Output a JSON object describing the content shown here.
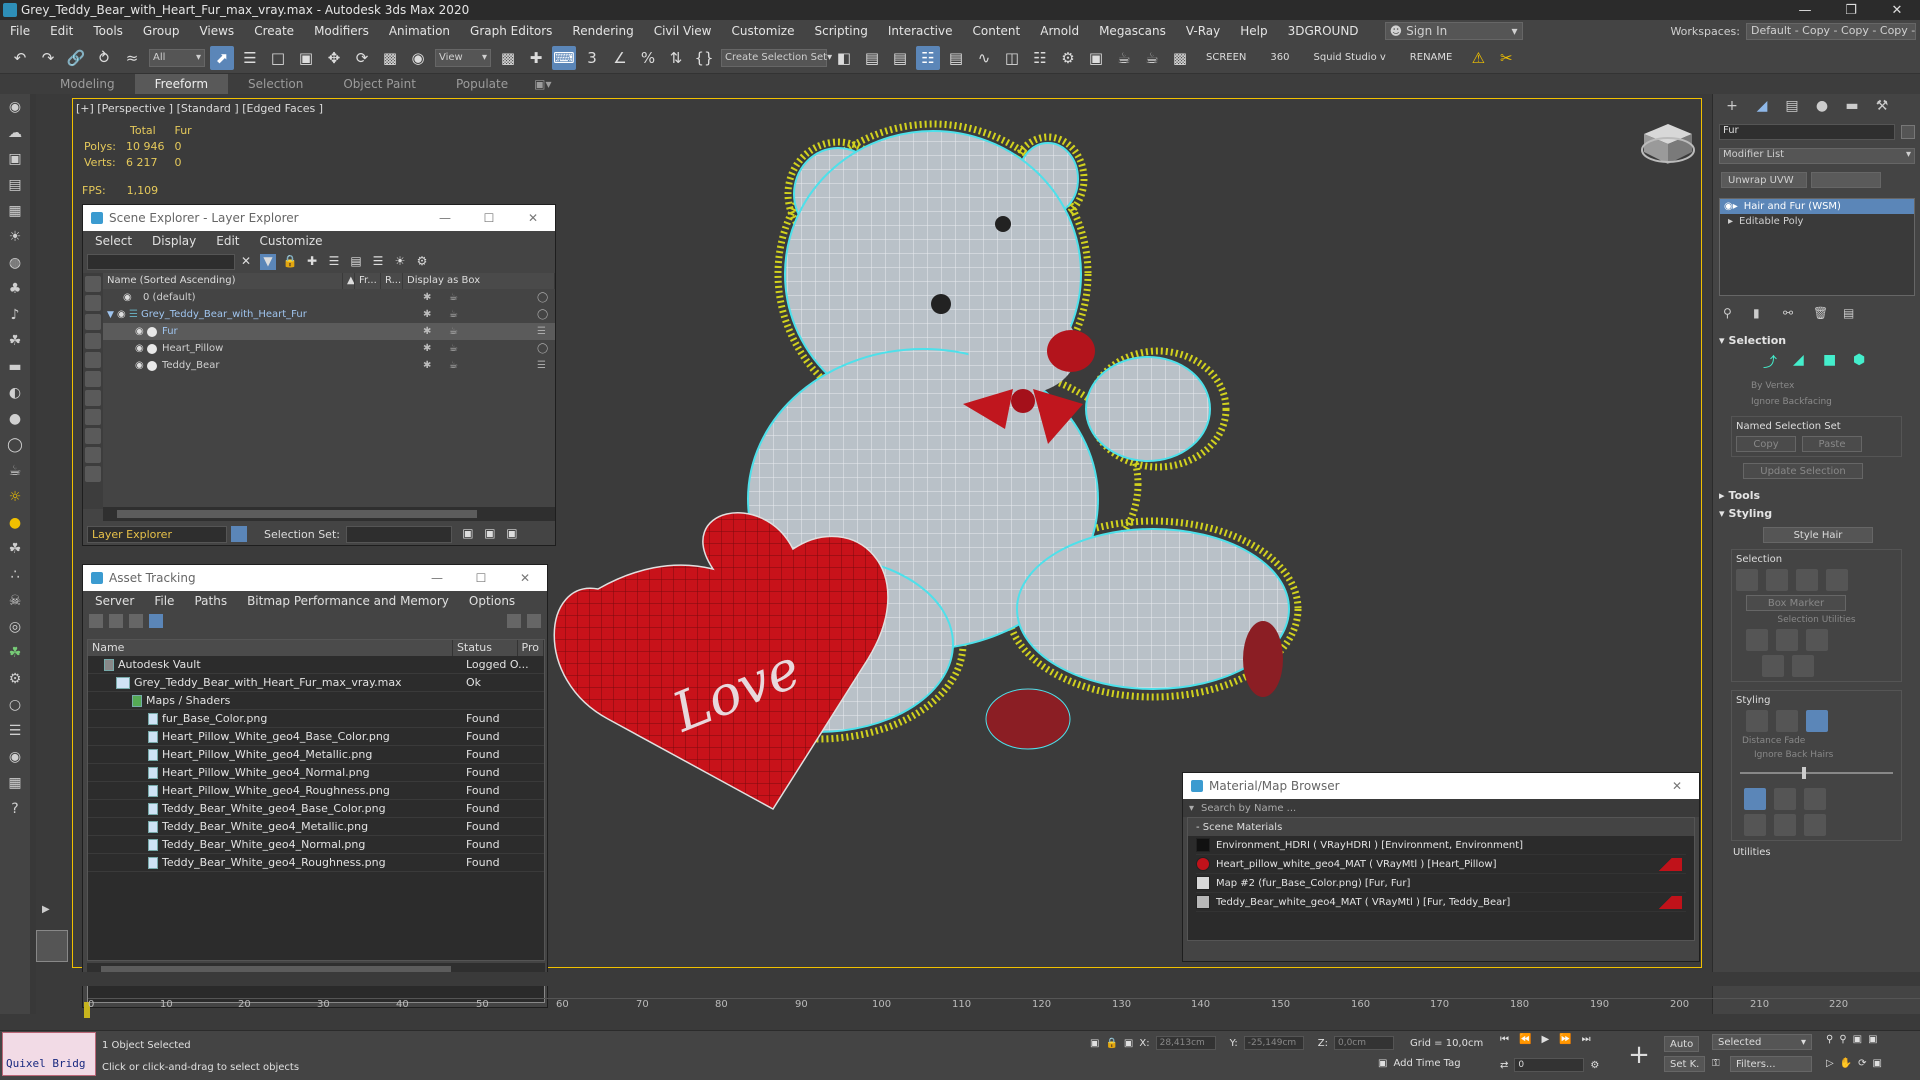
{
  "window": {
    "title": "Grey_Teddy_Bear_with_Heart_Fur_max_vray.max - Autodesk 3ds Max 2020"
  },
  "menu": {
    "items": [
      "File",
      "Edit",
      "Tools",
      "Group",
      "Views",
      "Create",
      "Modifiers",
      "Animation",
      "Graph Editors",
      "Rendering",
      "Civil View",
      "Customize",
      "Scripting",
      "Interactive",
      "Content",
      "Arnold",
      "Megascans",
      "V-Ray",
      "Help",
      "3DGROUND"
    ],
    "sign_in": "Sign In",
    "workspaces_label": "Workspaces:",
    "workspace_value": "Default - Copy - Copy - Copy - Copy"
  },
  "toolbar": {
    "filter": "All",
    "ref_coord": "View",
    "selection_set": "Create Selection Set",
    "screen": "SCREEN",
    "num360": "360",
    "squid": "Squid Studio v",
    "rename": "RENAME"
  },
  "ribbon": {
    "tabs": [
      "Modeling",
      "Freeform",
      "Selection",
      "Object Paint",
      "Populate"
    ],
    "active": "Freeform"
  },
  "viewport": {
    "label": "[+] [Perspective ] [Standard ] [Edged Faces ]",
    "stats": {
      "head_total": "Total",
      "head_fur": "Fur",
      "polys_label": "Polys:",
      "polys_total": "10 946",
      "polys_fur": "0",
      "verts_label": "Verts:",
      "verts_total": "6 217",
      "verts_fur": "0"
    },
    "fps_label": "FPS:",
    "fps_value": "1,109",
    "heart_text": "Love"
  },
  "scene_explorer": {
    "title": "Scene Explorer - Layer Explorer",
    "menu": [
      "Select",
      "Display",
      "Edit",
      "Customize"
    ],
    "col_name": "Name (Sorted Ascending)",
    "col_fr": "Fr...",
    "col_r": "R...",
    "col_box": "Display as Box",
    "rows": [
      {
        "name": "0 (default)",
        "indent": 1
      },
      {
        "name": "Grey_Teddy_Bear_with_Heart_Fur",
        "indent": 0
      },
      {
        "name": "Fur",
        "indent": 2
      },
      {
        "name": "Heart_Pillow",
        "indent": 2
      },
      {
        "name": "Teddy_Bear",
        "indent": 2
      }
    ],
    "explorer_type": "Layer Explorer",
    "selection_set_label": "Selection Set:"
  },
  "asset_tracking": {
    "title": "Asset Tracking",
    "menu": [
      "Server",
      "File",
      "Paths",
      "Bitmap Performance and Memory",
      "Options"
    ],
    "col_name": "Name",
    "col_status": "Status",
    "col_pro": "Pro",
    "rows": [
      {
        "name": "Autodesk Vault",
        "status": "Logged O..."
      },
      {
        "name": "Grey_Teddy_Bear_with_Heart_Fur_max_vray.max",
        "status": "Ok"
      },
      {
        "name": "Maps / Shaders",
        "status": ""
      },
      {
        "name": "fur_Base_Color.png",
        "status": "Found"
      },
      {
        "name": "Heart_Pillow_White_geo4_Base_Color.png",
        "status": "Found"
      },
      {
        "name": "Heart_Pillow_White_geo4_Metallic.png",
        "status": "Found"
      },
      {
        "name": "Heart_Pillow_White_geo4_Normal.png",
        "status": "Found"
      },
      {
        "name": "Heart_Pillow_White_geo4_Roughness.png",
        "status": "Found"
      },
      {
        "name": "Teddy_Bear_White_geo4_Base_Color.png",
        "status": "Found"
      },
      {
        "name": "Teddy_Bear_White_geo4_Metallic.png",
        "status": "Found"
      },
      {
        "name": "Teddy_Bear_White_geo4_Normal.png",
        "status": "Found"
      },
      {
        "name": "Teddy_Bear_White_geo4_Roughness.png",
        "status": "Found"
      }
    ]
  },
  "material_browser": {
    "title": "Material/Map Browser",
    "search_placeholder": "Search by Name ...",
    "group": "- Scene Materials",
    "rows": [
      {
        "name": "Environment_HDRI  ( VRayHDRI ) [Environment, Environment]",
        "swatch": "#111111"
      },
      {
        "name": "Heart_pillow_white_geo4_MAT  ( VRayMtl ) [Heart_Pillow]",
        "swatch": "#c0121a"
      },
      {
        "name": "Map #2 (fur_Base_Color.png) [Fur, Fur]",
        "swatch": "#d8d8d8"
      },
      {
        "name": "Teddy_Bear_white_geo4_MAT  ( VRayMtl ) [Fur, Teddy_Bear]",
        "swatch": "#b8b8b8"
      }
    ]
  },
  "command_panel": {
    "object_name": "Fur",
    "modifier_list": "Modifier List",
    "unwrap_button": "Unwrap UVW",
    "stack": [
      "Hair and Fur (WSM)",
      "Editable Poly"
    ],
    "selection": {
      "title": "Selection",
      "by_vertex": "By Vertex",
      "ignore_backfacing": "Ignore Backfacing",
      "named_sets": "Named Selection Set",
      "copy": "Copy",
      "paste": "Paste",
      "update": "Update Selection"
    },
    "tools_title": "Tools",
    "styling": {
      "title": "Styling",
      "style_hair": "Style Hair",
      "selection": "Selection",
      "box_marker": "Box Marker",
      "selection_utilities": "Selection Utilities",
      "styling_sub": "Styling",
      "distance_fade": "Distance Fade",
      "ignore_back_hairs": "Ignore Back Hairs",
      "utilities": "Utilities"
    }
  },
  "timeline": {
    "ticks": [
      "0",
      "10",
      "20",
      "30",
      "40",
      "50",
      "60",
      "70",
      "80",
      "90",
      "100",
      "110",
      "120",
      "130",
      "140",
      "150",
      "160",
      "170",
      "180",
      "190",
      "200",
      "210",
      "220"
    ]
  },
  "status": {
    "quixel": "Quixel Bridg",
    "selected": "1 Object Selected",
    "hint": "Click or click-and-drag to select objects",
    "x_label": "X:",
    "x_val": "28,413cm",
    "y_label": "Y:",
    "y_val": "-25,149cm",
    "z_label": "Z:",
    "z_val": "0,0cm",
    "grid": "Grid = 10,0cm",
    "add_time_tag": "Add Time Tag",
    "auto": "Auto",
    "selected_dd": "Selected",
    "setk": "Set K.",
    "filters": "Filters...",
    "frame": "0"
  }
}
